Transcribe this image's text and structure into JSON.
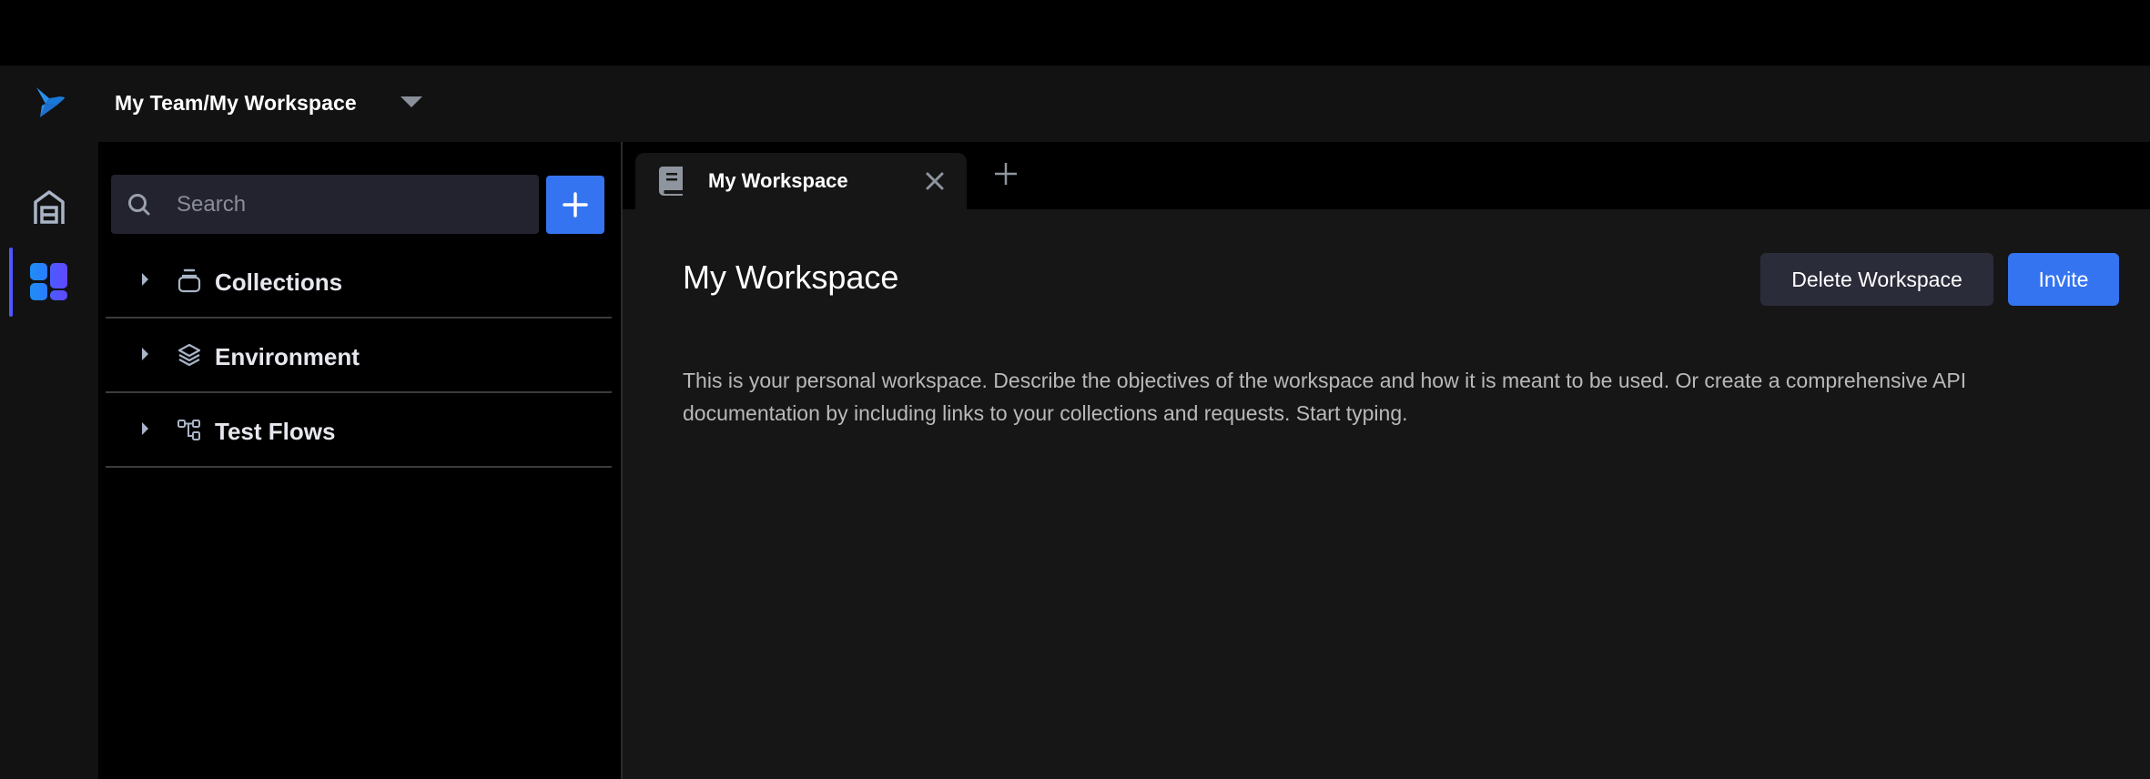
{
  "header": {
    "workspace_title": "My Team/My Workspace",
    "logo_icon": "bird-logo-icon",
    "dropdown_icon": "caret-down-icon"
  },
  "rail": {
    "items": [
      {
        "name": "home",
        "icon": "home-icon",
        "active": false
      },
      {
        "name": "workspace",
        "icon": "workspace-grid-icon",
        "active": true
      }
    ],
    "accent_color": "#4f56ff"
  },
  "sidebar": {
    "search": {
      "placeholder": "Search",
      "value": ""
    },
    "add_button_icon": "plus-icon",
    "items": [
      {
        "label": "Collections",
        "icon": "collections-icon"
      },
      {
        "label": "Environment",
        "icon": "layers-icon"
      },
      {
        "label": "Test Flows",
        "icon": "flow-icon"
      }
    ]
  },
  "tabs": {
    "items": [
      {
        "label": "My Workspace",
        "icon": "book-icon",
        "active": true
      }
    ],
    "add_tab_icon": "plus-icon"
  },
  "main": {
    "title": "My Workspace",
    "delete_label": "Delete Workspace",
    "invite_label": "Invite",
    "description": "This is your personal workspace. Describe the objectives of the workspace and how it is meant to be used. Or create a comprehensive API documentation by including links to your collections and requests. Start typing."
  },
  "colors": {
    "primary": "#3574f0",
    "secondary_button": "#2b2c3a",
    "header_bg": "#121212",
    "content_bg": "#161616"
  }
}
